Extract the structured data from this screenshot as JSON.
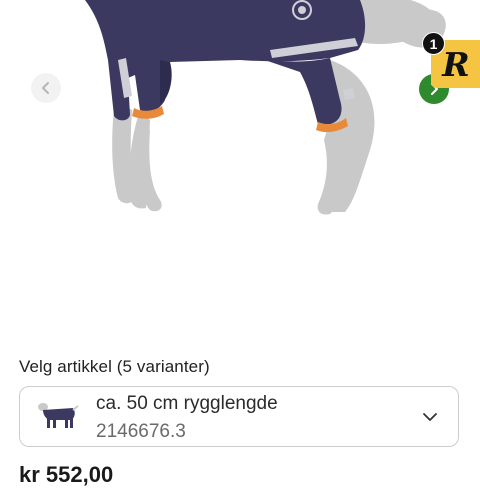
{
  "gallery": {
    "image_subject": "dog-raincoat-product-photo",
    "prev_icon": "chevron-left-icon",
    "next_icon": "chevron-right-icon"
  },
  "badge": {
    "letter": "R",
    "count": "1",
    "colors": {
      "background": "#f6c443",
      "count_background": "#111111"
    }
  },
  "variants": {
    "title": "Velg artikkel (5 varianter)",
    "selected": {
      "name": "ca. 50 cm rygglengde",
      "sku": "2146676.3"
    },
    "dropdown_icon": "chevron-down-icon"
  },
  "price": {
    "value": "kr 552,00"
  },
  "colors": {
    "accent_green": "#2f8a2e",
    "coat_purple": "#3b3960",
    "reflective_grey": "#cfcfd8",
    "cuff_orange": "#e88a3a"
  }
}
